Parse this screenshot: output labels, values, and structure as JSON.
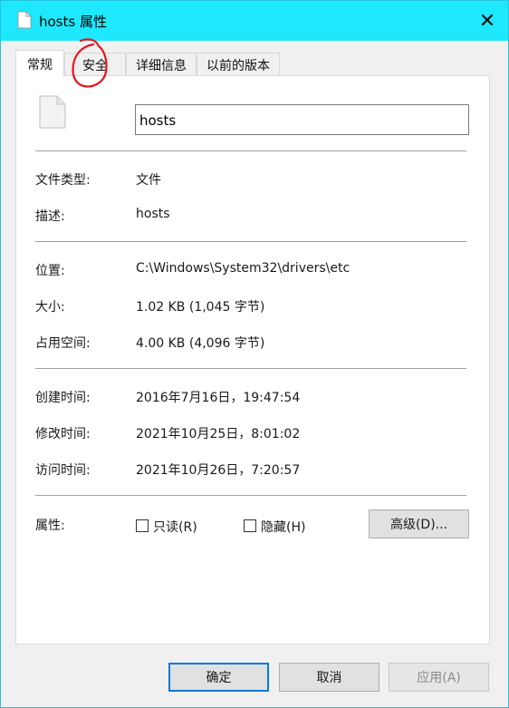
{
  "window": {
    "title": "hosts 属性",
    "close_icon": "close-icon",
    "title_icon": "document-icon"
  },
  "tabs": [
    {
      "label": "常规",
      "active": true
    },
    {
      "label": "安全",
      "active": false
    },
    {
      "label": "详细信息",
      "active": false
    },
    {
      "label": "以前的版本",
      "active": false
    }
  ],
  "general": {
    "file_name": "hosts",
    "file_type_label": "文件类型:",
    "file_type_value": "文件",
    "description_label": "描述:",
    "description_value": "hosts",
    "location_label": "位置:",
    "location_value": "C:\\Windows\\System32\\drivers\\etc",
    "size_label": "大小:",
    "size_value": "1.02 KB (1,045 字节)",
    "size_on_disk_label": "占用空间:",
    "size_on_disk_value": "4.00 KB (4,096 字节)",
    "created_label": "创建时间:",
    "created_value": "2016年7月16日，19:47:54",
    "modified_label": "修改时间:",
    "modified_value": "2021年10月25日，8:01:02",
    "accessed_label": "访问时间:",
    "accessed_value": "2021年10月26日，7:20:57",
    "attributes_label": "属性:",
    "readonly_label": "只读(R)",
    "readonly_checked": false,
    "hidden_label": "隐藏(H)",
    "hidden_checked": false,
    "advanced_button": "高级(D)..."
  },
  "buttons": {
    "ok": "确定",
    "cancel": "取消",
    "apply": "应用(A)"
  },
  "colors": {
    "titlebar": "#1ee8fc",
    "annotation": "#e8151b",
    "default_button_border": "#0078d7"
  }
}
